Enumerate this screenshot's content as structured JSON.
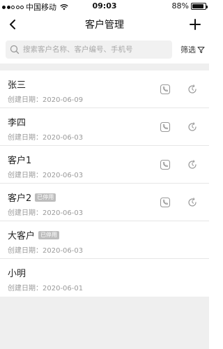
{
  "status_bar": {
    "carrier": "中国移动",
    "time": "09:03",
    "battery_percent": "88%",
    "battery_level": 0.88,
    "signal_bars": 2,
    "signal_total": 5
  },
  "nav": {
    "title": "客户管理",
    "back_icon": "chevron-left-icon",
    "add_icon": "plus-icon"
  },
  "search": {
    "placeholder": "搜索客户名称、客户编号、手机号",
    "value": "",
    "filter_label": "筛选"
  },
  "colors": {
    "badge_bg": "#bdbdbd",
    "list_bg": "#efefef",
    "secondary_text": "#9a9a9a"
  },
  "customers": [
    {
      "name": "张三",
      "badge": "",
      "date_label": "创建日期：",
      "date": "2020-06-09",
      "has_actions": true
    },
    {
      "name": "李四",
      "badge": "",
      "date_label": "创建日期：",
      "date": "2020-06-03",
      "has_actions": true
    },
    {
      "name": "客户1",
      "badge": "",
      "date_label": "创建日期：",
      "date": "2020-06-03",
      "has_actions": true
    },
    {
      "name": "客户2",
      "badge": "已停用",
      "date_label": "创建日期：",
      "date": "2020-06-03",
      "has_actions": true
    },
    {
      "name": "大客户",
      "badge": "已停用",
      "date_label": "创建日期：",
      "date": "2020-06-03",
      "has_actions": false
    },
    {
      "name": "小明",
      "badge": "",
      "date_label": "创建日期：",
      "date": "2020-06-01",
      "has_actions": false
    }
  ]
}
